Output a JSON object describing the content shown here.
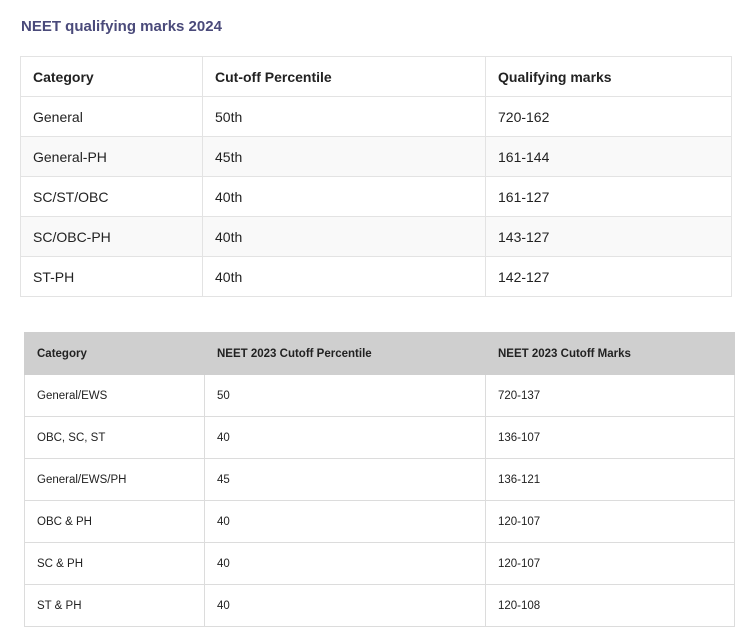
{
  "section_title": "NEET qualifying marks 2024",
  "table_2024": {
    "headers": [
      "Category",
      "Cut-off Percentile",
      "Qualifying marks"
    ],
    "rows": [
      [
        "General",
        "50th",
        "720-162"
      ],
      [
        "General-PH",
        "45th",
        "161-144"
      ],
      [
        "SC/ST/OBC",
        "40th",
        "161-127"
      ],
      [
        "SC/OBC-PH",
        "40th",
        "143-127"
      ],
      [
        "ST-PH",
        "40th",
        "142-127"
      ]
    ]
  },
  "table_2023": {
    "headers": [
      "Category",
      "NEET 2023 Cutoff Percentile",
      "NEET 2023 Cutoff Marks"
    ],
    "rows": [
      [
        "General/EWS",
        "50",
        "720-137"
      ],
      [
        "OBC, SC, ST",
        "40",
        "136-107"
      ],
      [
        "General/EWS/PH",
        "45",
        "136-121"
      ],
      [
        "OBC & PH",
        "40",
        "120-107"
      ],
      [
        "SC & PH",
        "40",
        "120-107"
      ],
      [
        "ST & PH",
        "40",
        "120-108"
      ]
    ]
  },
  "colors": {
    "title": "#4a4a7a",
    "header_bg_2023": "#cfcfcf",
    "border": "#e3e3e3"
  }
}
